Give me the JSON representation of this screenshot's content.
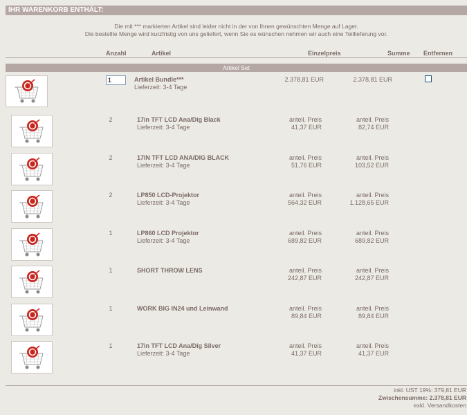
{
  "header": {
    "title": "IHR WARENKORB ENTHÄLT:"
  },
  "notice": {
    "line1": "Die mit *** markierten Artikel sind leider nicht in der von Ihnen gewünschten Menge auf Lager.",
    "line2": "Die bestellte Menge wird kurzfristig von uns geliefert, wenn Sie es wünschen nehmen wir auch eine Teillieferung vor."
  },
  "columns": {
    "anzahl": "Anzahl",
    "artikel": "Artikel",
    "einzelpreis": "Einzelpreis",
    "summe": "Summe",
    "entfernen": "Entfernen"
  },
  "set_label": "Artikel Set",
  "bundle": {
    "qty": "1",
    "name": "Artikel Bundle***",
    "delivery": "Lieferzeit: 3-4 Tage",
    "unit_price": "2.378,81 EUR",
    "total": "2.378,81 EUR",
    "remove_checked": false
  },
  "items": [
    {
      "qty": "2",
      "name": "17in TFT LCD Ana/Dig Black",
      "delivery": "Lieferzeit: 3-4 Tage",
      "price_label": "anteil. Preis",
      "unit_price": "41,37 EUR",
      "total_label": "anteil. Preis",
      "total": "82,74 EUR"
    },
    {
      "qty": "2",
      "name": "17IN TFT LCD ANA/DIG BLACK",
      "delivery": "Lieferzeit: 3-4 Tage",
      "price_label": "anteil. Preis",
      "unit_price": "51,76 EUR",
      "total_label": "anteil. Preis",
      "total": "103,52 EUR"
    },
    {
      "qty": "2",
      "name": "LP850 LCD-Projektor",
      "delivery": "Lieferzeit: 3-4 Tage",
      "price_label": "anteil. Preis",
      "unit_price": "564,32 EUR",
      "total_label": "anteil. Preis",
      "total": "1.128,65 EUR"
    },
    {
      "qty": "1",
      "name": "LP860 LCD Projektor",
      "delivery": "Lieferzeit: 3-4 Tage",
      "price_label": "anteil. Preis",
      "unit_price": "689,82 EUR",
      "total_label": "anteil. Preis",
      "total": "689,82 EUR"
    },
    {
      "qty": "1",
      "name": "SHORT THROW LENS",
      "delivery": "",
      "price_label": "anteil. Preis",
      "unit_price": "242,87 EUR",
      "total_label": "anteil. Preis",
      "total": "242,87 EUR"
    },
    {
      "qty": "1",
      "name": "WORK BIG IN24 und Leinwand",
      "delivery": "",
      "price_label": "anteil. Preis",
      "unit_price": "89,84 EUR",
      "total_label": "anteil. Preis",
      "total": "89,84 EUR"
    },
    {
      "qty": "1",
      "name": "17in TFT LCD Ana/Dig Silver",
      "delivery": "Lieferzeit: 3-4 Tage",
      "price_label": "anteil. Preis",
      "unit_price": "41,37 EUR",
      "total_label": "anteil. Preis",
      "total": "41,37 EUR"
    }
  ],
  "footer": {
    "tax": "inkl. UST 19%: 379,81 EUR",
    "subtotal": "Zwischensumme: 2.378,81 EUR",
    "shipping": "exkl. Versandkosten"
  },
  "colors": {
    "accent": "#b5a7a3",
    "text": "#7a6a66",
    "background": "#eceae4"
  }
}
